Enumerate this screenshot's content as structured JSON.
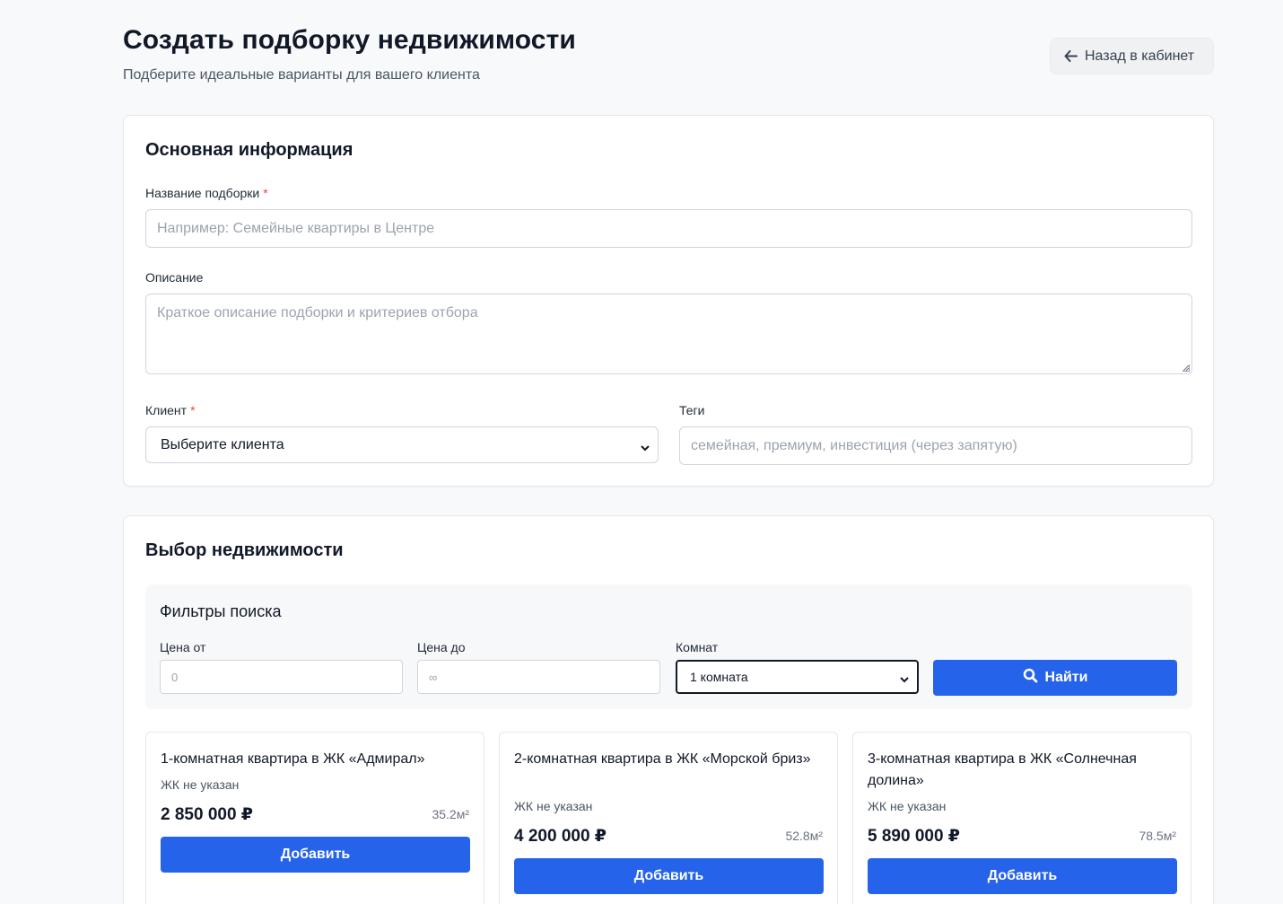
{
  "header": {
    "title": "Создать подборку недвижимости",
    "subtitle": "Подберите идеальные варианты для вашего клиента",
    "back_label": "Назад в кабинет"
  },
  "basic_info": {
    "section_title": "Основная информация",
    "name_label": "Название подборки",
    "name_placeholder": "Например: Семейные квартиры в Центре",
    "description_label": "Описание",
    "description_placeholder": "Краткое описание подборки и критериев отбора",
    "client_label": "Клиент",
    "client_selected": "Выберите клиента",
    "tags_label": "Теги",
    "tags_placeholder": "семейная, премиум, инвестиция (через запятую)",
    "required_mark": "*"
  },
  "property_selection": {
    "section_title": "Выбор недвижимости",
    "filters": {
      "title": "Фильтры поиска",
      "price_from_label": "Цена от",
      "price_from_placeholder": "0",
      "price_to_label": "Цена до",
      "price_to_placeholder": "∞",
      "rooms_label": "Комнат",
      "rooms_selected": "1 комната",
      "find_label": "Найти"
    },
    "properties": [
      {
        "title": "1-комнатная квартира в ЖК «Адмирал»",
        "complex": "ЖК не указан",
        "price": "2 850 000 ₽",
        "area": "35.2м²",
        "add_label": "Добавить"
      },
      {
        "title": "2-комнатная квартира в ЖК «Морской бриз»",
        "complex": "ЖК не указан",
        "price": "4 200 000 ₽",
        "area": "52.8м²",
        "add_label": "Добавить"
      },
      {
        "title": "3-комнатная квартира в ЖК «Солнечная долина»",
        "complex": "ЖК не указан",
        "price": "5 890 000 ₽",
        "area": "78.5м²",
        "add_label": "Добавить"
      }
    ]
  },
  "colors": {
    "primary": "#2563eb",
    "background": "#f8f9fb",
    "required": "#ef4444"
  }
}
